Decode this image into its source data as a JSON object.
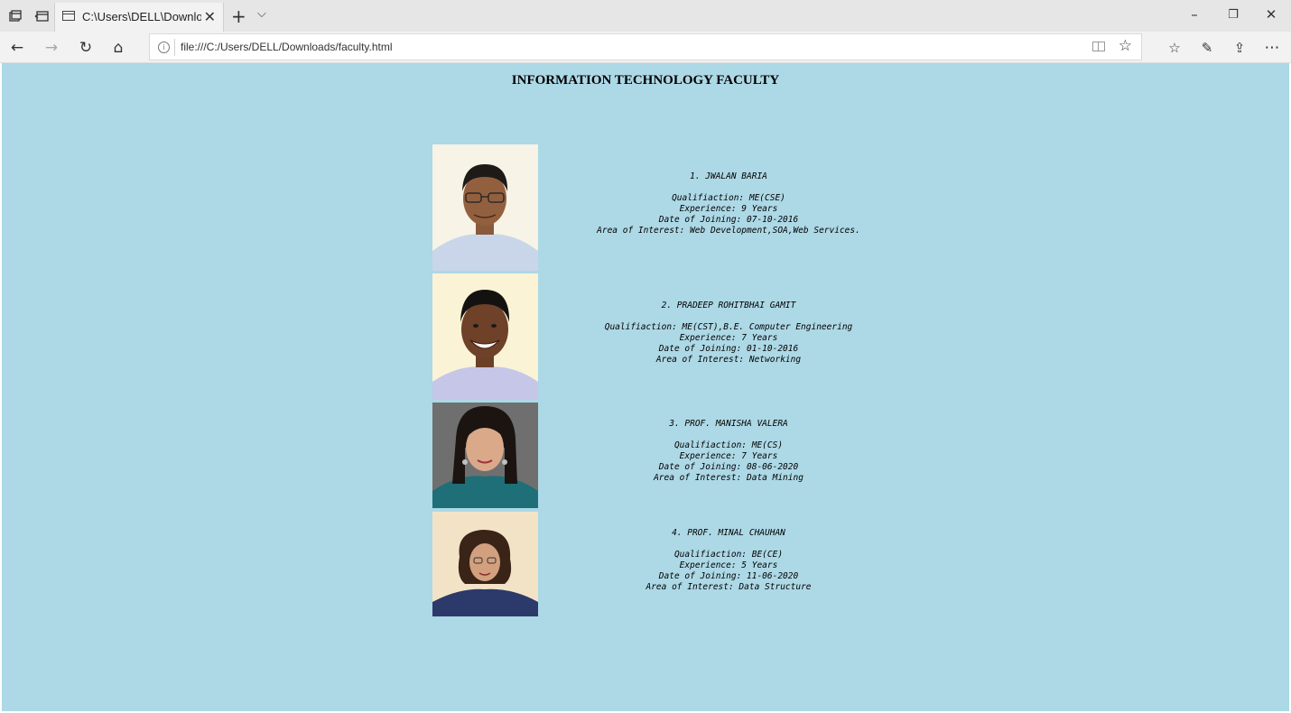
{
  "browser": {
    "tab_title": "C:\\Users\\DELL\\Downloa",
    "address_url": "file:///C:/Users/DELL/Downloads/faculty.html"
  },
  "page": {
    "heading": "INFORMATION TECHNOLOGY FACULTY",
    "background_color": "#add8e6",
    "faculty": [
      {
        "name": "1. JWALAN BARIA",
        "qualification": "Qualifiaction: ME(CSE)",
        "experience": "Experience: 9 Years",
        "joining": "Date of Joining: 07-10-2016",
        "interest": "Area of Interest: Web Development,SOA,Web Services."
      },
      {
        "name": "2. PRADEEP ROHITBHAI GAMIT",
        "qualification": "Qualifiaction: ME(CST),B.E. Computer Engineering",
        "experience": "Experience: 7 Years",
        "joining": "Date of Joining: 01-10-2016",
        "interest": "Area of Interest: Networking"
      },
      {
        "name": "3. PROF. MANISHA VALERA",
        "qualification": "Qualifiaction: ME(CS)",
        "experience": "Experience: 7 Years",
        "joining": "Date of Joining: 08-06-2020",
        "interest": "Area of Interest: Data Mining"
      },
      {
        "name": "4. PROF. MINAL CHAUHAN",
        "qualification": "Qualifiaction: BE(CE)",
        "experience": "Experience: 5 Years",
        "joining": "Date of Joining: 11-06-2020",
        "interest": "Area of Interest: Data Structure"
      }
    ]
  },
  "icons": {
    "tab_actions": "tab-set-aside-icon",
    "tab_preview": "tab-preview-icon",
    "page": "page-icon",
    "close_tab": "close-icon",
    "new_tab": "plus-icon",
    "tab_menu": "chevron-down-icon",
    "minimize": "minimize-icon",
    "restore": "restore-icon",
    "close_window": "close-icon",
    "back": "back-arrow-icon",
    "forward": "forward-arrow-icon",
    "refresh": "refresh-icon",
    "home": "home-icon",
    "info": "info-icon",
    "reading_view": "reading-view-icon",
    "favorite": "star-icon",
    "favorites": "favorites-list-icon",
    "notes": "pen-icon",
    "share": "share-icon",
    "more": "more-icon"
  }
}
